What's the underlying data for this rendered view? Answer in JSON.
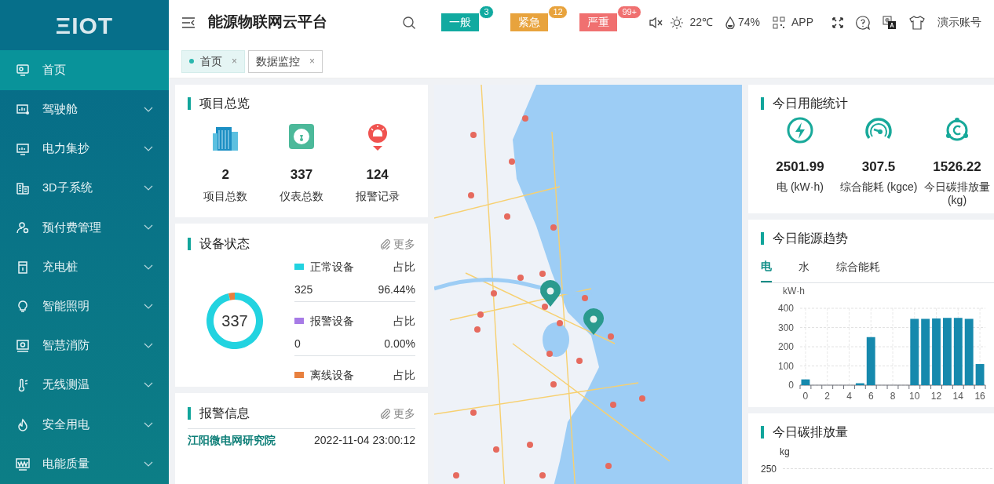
{
  "logo": {
    "text": "ΞIOT"
  },
  "sidebar": {
    "items": [
      {
        "label": "首页",
        "selected": true,
        "has_children": false
      },
      {
        "label": "驾驶舱",
        "selected": false,
        "has_children": true
      },
      {
        "label": "电力集抄",
        "selected": false,
        "has_children": true
      },
      {
        "label": "3D子系统",
        "selected": false,
        "has_children": true
      },
      {
        "label": "预付费管理",
        "selected": false,
        "has_children": true
      },
      {
        "label": "充电桩",
        "selected": false,
        "has_children": true
      },
      {
        "label": "智能照明",
        "selected": false,
        "has_children": true
      },
      {
        "label": "智慧消防",
        "selected": false,
        "has_children": true
      },
      {
        "label": "无线测温",
        "selected": false,
        "has_children": true
      },
      {
        "label": "安全用电",
        "selected": false,
        "has_children": true
      },
      {
        "label": "电能质量",
        "selected": false,
        "has_children": true
      }
    ]
  },
  "header": {
    "title": "能源物联网云平台",
    "alarms": [
      {
        "label": "一般",
        "count": "3",
        "color": "#11aaa0"
      },
      {
        "label": "紧急",
        "count": "12",
        "color": "#e8a33d"
      },
      {
        "label": "严重",
        "count": "99+",
        "color": "#f07070"
      }
    ],
    "muted": true,
    "temperature": "22℃",
    "humidity": "74%",
    "app": "APP",
    "account": "演示账号"
  },
  "tabs": [
    {
      "label": "首页",
      "selected": true,
      "close": "×"
    },
    {
      "label": "数据监控",
      "selected": false,
      "close": "×"
    }
  ],
  "overview": {
    "title": "项目总览",
    "items": [
      {
        "kind": "building",
        "value": "2",
        "label": "项目总数"
      },
      {
        "kind": "meter",
        "value": "337",
        "label": "仪表总数"
      },
      {
        "kind": "alarm",
        "value": "124",
        "label": "报警记录"
      }
    ]
  },
  "device_status": {
    "title": "设备状态",
    "more": "更多",
    "total": "337",
    "chart_data": {
      "type": "donut",
      "categories": [
        "正常设备",
        "报警设备",
        "离线设备"
      ],
      "values": [
        96.44,
        0,
        3.56
      ]
    },
    "items": [
      {
        "ratio_label": "占比",
        "count": "325",
        "percent": "96.44%",
        "color": "#22d3e0"
      },
      {
        "ratio_label": "占比",
        "count": "0",
        "percent": "0.00%",
        "color": "#a77be6"
      },
      {
        "ratio_label": "占比",
        "color": "#e8803f"
      }
    ]
  },
  "alarm_info": {
    "title": "报警信息",
    "more": "更多",
    "rows": [
      {
        "name": "江阳微电网研究院",
        "time": "2022-11-04 23:00:12"
      }
    ]
  },
  "energy_stats": {
    "title": "今日用能统计",
    "items": [
      {
        "kind": "electric",
        "value": "2501.99",
        "label": "电 (kW·h)"
      },
      {
        "kind": "gauge",
        "value": "307.5",
        "label": "综合能耗 (kgce)"
      },
      {
        "kind": "carbon",
        "value": "1526.22",
        "label": "今日碳排放量 (kg)"
      }
    ]
  },
  "energy_trend": {
    "title": "今日能源趋势",
    "tabs": [
      {
        "label": "电",
        "selected": true
      },
      {
        "label": "水",
        "selected": false
      },
      {
        "label": "综合能耗",
        "selected": false
      }
    ],
    "chart_data": {
      "type": "bar",
      "ylabel": "kW·h",
      "x": [
        0,
        1,
        2,
        3,
        4,
        5,
        6,
        7,
        8,
        9,
        10,
        11,
        12,
        13,
        14,
        15,
        16
      ],
      "series": [
        {
          "color": "#1689ad",
          "values": [
            30,
            0,
            0,
            0,
            0,
            10,
            250,
            0,
            0,
            0,
            345,
            345,
            347,
            350,
            350,
            345,
            110
          ]
        }
      ],
      "xlim": [
        -0.5,
        16.5
      ],
      "ylim": [
        0,
        400
      ],
      "grid": true,
      "yticks": [
        0,
        100,
        200,
        300,
        400
      ],
      "xticks": [
        0,
        2,
        4,
        6,
        8,
        10,
        12,
        14,
        16
      ]
    }
  },
  "carbon": {
    "title": "今日碳排放量",
    "unit": "kg",
    "ytick": "250"
  }
}
